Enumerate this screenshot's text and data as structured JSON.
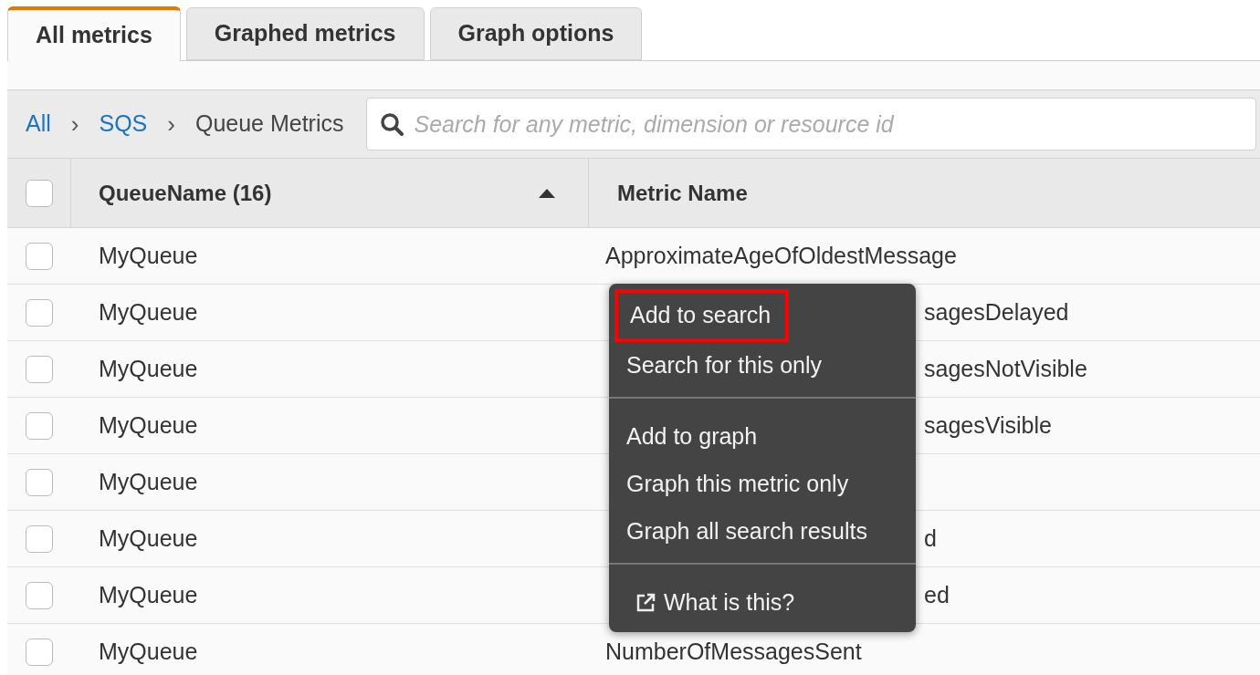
{
  "tabs": [
    {
      "label": "All metrics",
      "selected": true
    },
    {
      "label": "Graphed metrics",
      "selected": false
    },
    {
      "label": "Graph options",
      "selected": false
    }
  ],
  "breadcrumb": [
    {
      "label": "All",
      "kind": "link"
    },
    {
      "label": "SQS",
      "kind": "link"
    },
    {
      "label": "Queue Metrics",
      "kind": "current"
    }
  ],
  "breadcrumb_separator": "›",
  "search": {
    "placeholder": "Search for any metric, dimension or resource id"
  },
  "table": {
    "columns": [
      {
        "label": "QueueName (16)",
        "sorted": true
      },
      {
        "label": "Metric Name",
        "sorted": false
      }
    ],
    "header_checked": false,
    "rows": [
      {
        "checked": false,
        "queue": "MyQueue",
        "metric": "ApproximateAgeOfOldestMessage",
        "kind": "full"
      },
      {
        "checked": false,
        "queue": "MyQueue",
        "metric": "sagesDelayed",
        "kind": "partial"
      },
      {
        "checked": false,
        "queue": "MyQueue",
        "metric": "sagesNotVisible",
        "kind": "partial"
      },
      {
        "checked": false,
        "queue": "MyQueue",
        "metric": "sagesVisible",
        "kind": "partial"
      },
      {
        "checked": false,
        "queue": "MyQueue",
        "kind": "partial"
      },
      {
        "checked": false,
        "queue": "MyQueue",
        "metric": "d",
        "kind": "partial"
      },
      {
        "checked": false,
        "queue": "MyQueue",
        "metric": "ed",
        "kind": "partial"
      },
      {
        "checked": false,
        "queue": "MyQueue",
        "metric": "NumberOfMessagesSent",
        "kind": "full"
      }
    ]
  },
  "context_menu": {
    "groups": [
      [
        {
          "label": "Add to search",
          "highlighted": true
        },
        {
          "label": "Search for this only",
          "highlighted": false
        }
      ],
      [
        {
          "label": "Add to graph",
          "highlighted": false
        },
        {
          "label": "Graph this metric only",
          "highlighted": false
        },
        {
          "label": "Graph all search results",
          "highlighted": false
        }
      ],
      [
        {
          "label": "What is this?",
          "highlighted": false,
          "external": true
        }
      ]
    ]
  }
}
